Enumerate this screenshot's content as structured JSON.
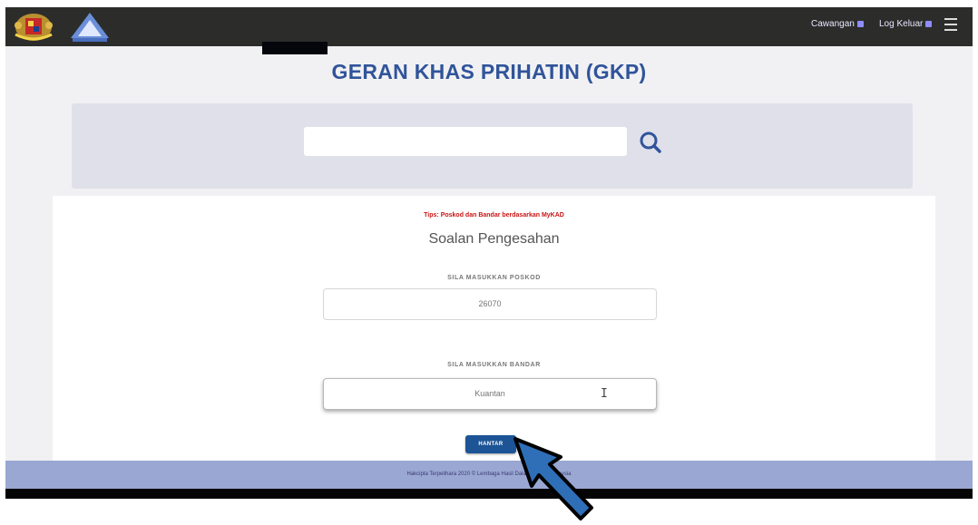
{
  "header": {
    "branch_link": "Cawangan",
    "logout_link": "Log Keluar"
  },
  "page": {
    "title": "GERAN KHAS PRIHATIN (GKP)"
  },
  "search": {
    "value": "",
    "icon": "search-icon"
  },
  "form": {
    "tips": "Tips: Poskod dan Bandar berdasarkan MyKAD",
    "subtitle": "Soalan Pengesahan",
    "poskod_label": "SILA MASUKKAN POSKOD",
    "poskod_placeholder": "26070",
    "bandar_label": "SILA MASUKKAN BANDAR",
    "bandar_placeholder": "Kuantan",
    "submit_label": "HANTAR"
  },
  "footer": {
    "text": "Hakcipta Terpelihara 2020 © Lembaga Hasil Dalam Negeri Malaysia"
  },
  "colors": {
    "topbar": "#2c2d2b",
    "title": "#30549a",
    "tips": "#c81414",
    "button": "#1c5495",
    "footer": "#9aa7d3",
    "arrow": "#2f6fb8"
  }
}
